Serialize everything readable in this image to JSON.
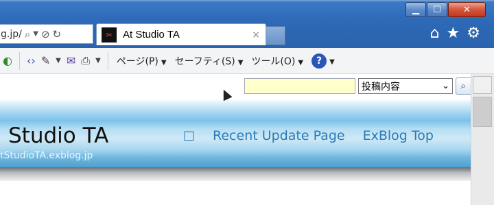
{
  "address": {
    "url": "g.jp/"
  },
  "tab": {
    "title": "At Studio TA",
    "close": "×"
  },
  "window": {
    "minimize": "▁",
    "maximize": "☐",
    "close": "✕"
  },
  "toolbar_icons": {
    "home": "⌂",
    "favorites": "★",
    "tools": "⚙"
  },
  "command_bar": {
    "page_menu": "ページ(P)",
    "safety_menu": "セーフティ(S)",
    "tools_menu": "ツール(O)",
    "help": "?"
  },
  "search": {
    "input_value": "",
    "select_value": "投稿内容"
  },
  "banner": {
    "title": "Studio TA",
    "nav": [
      {
        "label": "□"
      },
      {
        "label": "Recent Update Page"
      },
      {
        "label": "ExBlog Top"
      }
    ],
    "url": "tStudioTA.exblog.jp"
  },
  "colors": {
    "nav_link": "#2a7ab8",
    "frame": "#2e6ab8",
    "search_bg": "#ffffcc"
  }
}
